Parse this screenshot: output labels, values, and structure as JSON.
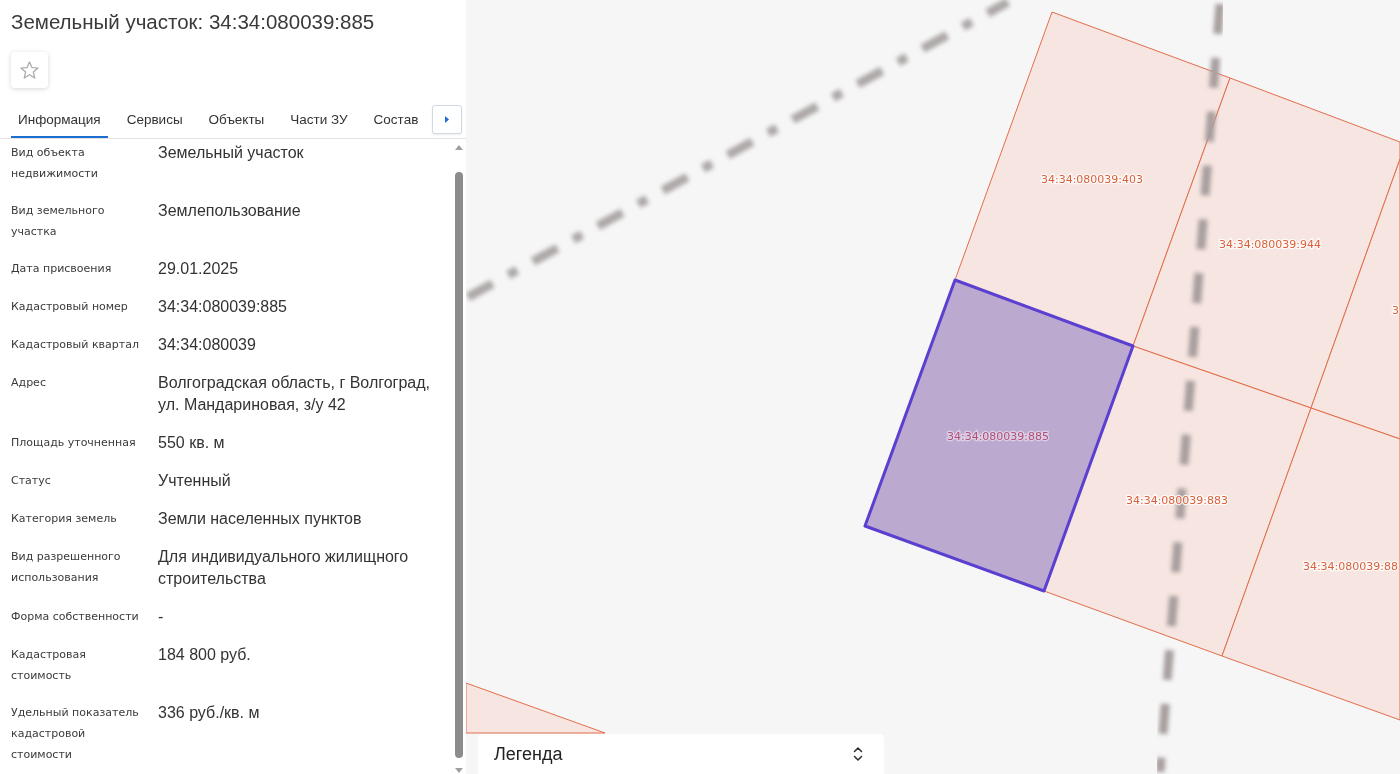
{
  "panel": {
    "title": "Земельный участок: 34:34:080039:885",
    "starred": false
  },
  "tabs": [
    {
      "label": "Информация",
      "selected": true
    },
    {
      "label": "Сервисы",
      "selected": false
    },
    {
      "label": "Объекты",
      "selected": false
    },
    {
      "label": "Части ЗУ",
      "selected": false
    },
    {
      "label": "Состав",
      "selected": false
    }
  ],
  "properties": [
    {
      "label": "Вид объекта недвижимости",
      "value": "Земельный участок"
    },
    {
      "label": "Вид земельного участка",
      "value": "Землепользование"
    },
    {
      "label": "Дата присвоения",
      "value": "29.01.2025"
    },
    {
      "label": "Кадастровый номер",
      "value": "34:34:080039:885"
    },
    {
      "label": "Кадастровый квартал",
      "value": "34:34:080039"
    },
    {
      "label": "Адрес",
      "value": "Волгоградская область, г Волгоград, ул. Мандариновая, з/у 42"
    },
    {
      "label": "Площадь уточненная",
      "value": "550 кв. м"
    },
    {
      "label": "Статус",
      "value": "Учтенный"
    },
    {
      "label": "Категория земель",
      "value": "Земли населенных пунктов"
    },
    {
      "label": "Вид разрешенного использования",
      "value": "Для индивидуального жилищного строительства"
    },
    {
      "label": "Форма собственности",
      "value": "-"
    },
    {
      "label": "Кадастровая стоимость",
      "value": "184 800 руб."
    },
    {
      "label": "Удельный показатель кадастровой стоимости",
      "value": "336 руб./кв. м"
    }
  ],
  "map": {
    "parcels": [
      {
        "label": "34:34:080039:403",
        "selected": false
      },
      {
        "label": "34:34:080039:944",
        "selected": false
      },
      {
        "label": "3",
        "selected": false
      },
      {
        "label": "34:34:080039:885",
        "selected": true
      },
      {
        "label": "34:34:080039:883",
        "selected": false
      },
      {
        "label": "34:34:080039:88",
        "selected": false
      }
    ],
    "legend": {
      "title": "Легенда"
    }
  }
}
